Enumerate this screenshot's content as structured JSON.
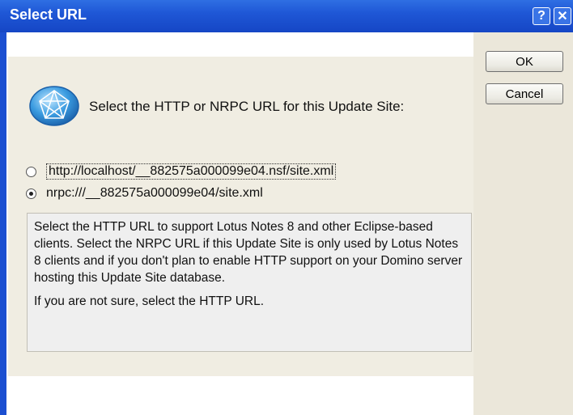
{
  "window": {
    "title": "Select URL",
    "help_glyph": "?",
    "close_glyph": "✕"
  },
  "buttons": {
    "ok_label": "OK",
    "cancel_label": "Cancel"
  },
  "prompt": "Select the HTTP or NRPC URL for this Update Site:",
  "options": [
    {
      "label": "http://localhost/__882575a000099e04.nsf/site.xml",
      "selected": false
    },
    {
      "label": "nrpc:///__882575a000099e04/site.xml",
      "selected": true
    }
  ],
  "info": {
    "paragraph1": "Select the HTTP URL to support Lotus Notes 8 and other Eclipse-based clients. Select the NRPC URL if this Update Site is only used by Lotus Notes 8 clients and if you don't plan to enable HTTP support on your Domino server hosting this Update Site database.",
    "paragraph2": "If you are not sure, select the HTTP URL."
  },
  "colors": {
    "titlebar": "#1f57d6",
    "dialog_bg": "#f0ede2",
    "logo_blue": "#2a8ad0"
  },
  "icons": {
    "logo": "lotus-update-site-icon"
  }
}
